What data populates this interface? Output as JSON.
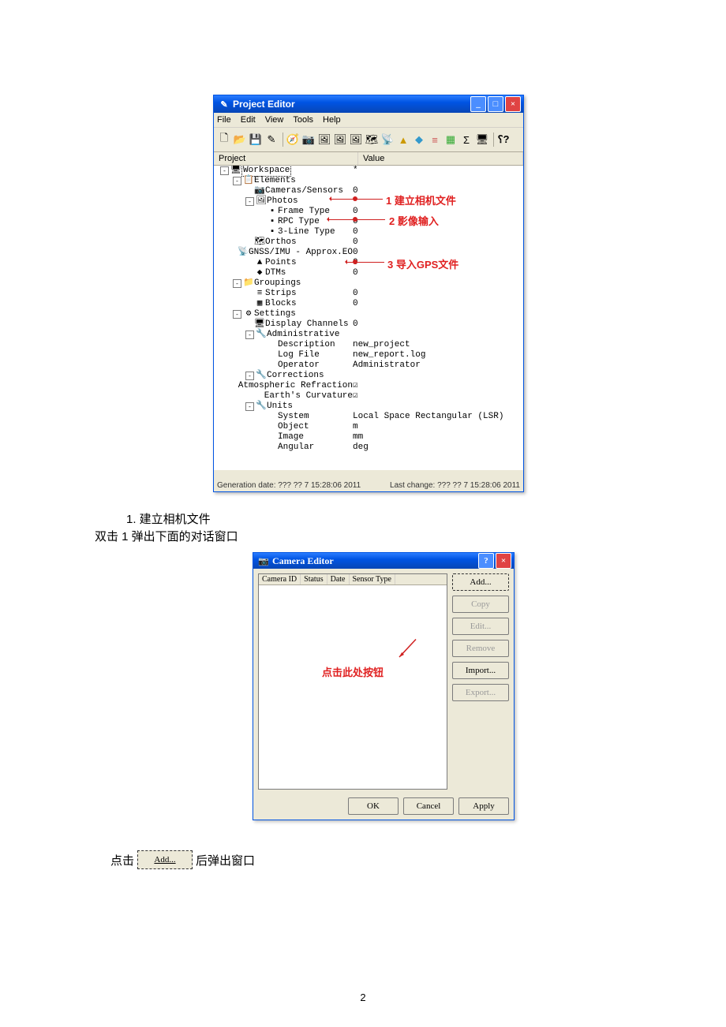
{
  "page_number": "2",
  "project_editor": {
    "title": "Project Editor",
    "menu": [
      "File",
      "Edit",
      "View",
      "Tools",
      "Help"
    ],
    "columns": {
      "project": "Project",
      "value": "Value"
    },
    "status_left": "Generation date: ??? ?? 7 15:28:06 2011",
    "status_right": "Last change: ??? ?? 7 15:28:06 2011",
    "rows": [
      {
        "indent": 0,
        "pm": "-",
        "icon": "🖥",
        "label": "Workspace",
        "value": "*"
      },
      {
        "indent": 1,
        "pm": "-",
        "icon": "📋",
        "label": "Elements",
        "value": ""
      },
      {
        "indent": 2,
        "pm": "",
        "icon": "📷",
        "label": "Cameras/Sensors",
        "value": "0"
      },
      {
        "indent": 2,
        "pm": "-",
        "icon": "🖼",
        "label": "Photos",
        "value": ""
      },
      {
        "indent": 3,
        "pm": "",
        "icon": "▪",
        "label": "Frame Type",
        "value": "0"
      },
      {
        "indent": 3,
        "pm": "",
        "icon": "▪",
        "label": "RPC Type",
        "value": "0"
      },
      {
        "indent": 3,
        "pm": "",
        "icon": "▪",
        "label": "3-Line Type",
        "value": "0"
      },
      {
        "indent": 2,
        "pm": "",
        "icon": "🗺",
        "label": "Orthos",
        "value": "0"
      },
      {
        "indent": 2,
        "pm": "",
        "icon": "📡",
        "label": "GNSS/IMU - Approx.EO",
        "value": "0"
      },
      {
        "indent": 2,
        "pm": "",
        "icon": "▲",
        "label": "Points",
        "value": "0"
      },
      {
        "indent": 2,
        "pm": "",
        "icon": "◆",
        "label": "DTMs",
        "value": "0"
      },
      {
        "indent": 1,
        "pm": "-",
        "icon": "📁",
        "label": "Groupings",
        "value": ""
      },
      {
        "indent": 2,
        "pm": "",
        "icon": "≡",
        "label": "Strips",
        "value": "0"
      },
      {
        "indent": 2,
        "pm": "",
        "icon": "▦",
        "label": "Blocks",
        "value": "0"
      },
      {
        "indent": 1,
        "pm": "-",
        "icon": "⚙",
        "label": "Settings",
        "value": ""
      },
      {
        "indent": 2,
        "pm": "",
        "icon": "🖥",
        "label": "Display Channels",
        "value": "0"
      },
      {
        "indent": 2,
        "pm": "-",
        "icon": "🔧",
        "label": "Administrative",
        "value": ""
      },
      {
        "indent": 3,
        "pm": "",
        "icon": "",
        "label": "Description",
        "value": "new_project"
      },
      {
        "indent": 3,
        "pm": "",
        "icon": "",
        "label": "Log File",
        "value": "new_report.log"
      },
      {
        "indent": 3,
        "pm": "",
        "icon": "",
        "label": "Operator",
        "value": "Administrator"
      },
      {
        "indent": 2,
        "pm": "-",
        "icon": "🔧",
        "label": "Corrections",
        "value": ""
      },
      {
        "indent": 3,
        "pm": "",
        "icon": "",
        "label": "Atmospheric Refraction",
        "value": "☑"
      },
      {
        "indent": 3,
        "pm": "",
        "icon": "",
        "label": "Earth's Curvature",
        "value": "☑"
      },
      {
        "indent": 2,
        "pm": "-",
        "icon": "🔧",
        "label": "Units",
        "value": ""
      },
      {
        "indent": 3,
        "pm": "",
        "icon": "",
        "label": "System",
        "value": "Local Space Rectangular (LSR)"
      },
      {
        "indent": 3,
        "pm": "",
        "icon": "",
        "label": "Object",
        "value": "m"
      },
      {
        "indent": 3,
        "pm": "",
        "icon": "",
        "label": "Image",
        "value": "mm"
      },
      {
        "indent": 3,
        "pm": "",
        "icon": "",
        "label": "Angular",
        "value": "deg"
      }
    ],
    "annotations": {
      "a1": "1 建立相机文件",
      "a2": "2  影像输入",
      "a3": "3 导入GPS文件"
    }
  },
  "body": {
    "heading": "1. 建立相机文件",
    "line2": "双击 1 弹出下面的对话窗口",
    "inline_prefix": "点击",
    "inline_btn": "Add...",
    "inline_suffix": "后弹出窗口"
  },
  "camera_editor": {
    "title": "Camera Editor",
    "list_headers": [
      "Camera ID",
      "Status",
      "Date",
      "Sensor Type"
    ],
    "buttons": {
      "add": "Add...",
      "copy": "Copy",
      "edit": "Edit...",
      "remove": "Remove",
      "import": "Import...",
      "export": "Export..."
    },
    "bottom": {
      "ok": "OK",
      "cancel": "Cancel",
      "apply": "Apply"
    },
    "annotation": "点击此处按钮"
  }
}
